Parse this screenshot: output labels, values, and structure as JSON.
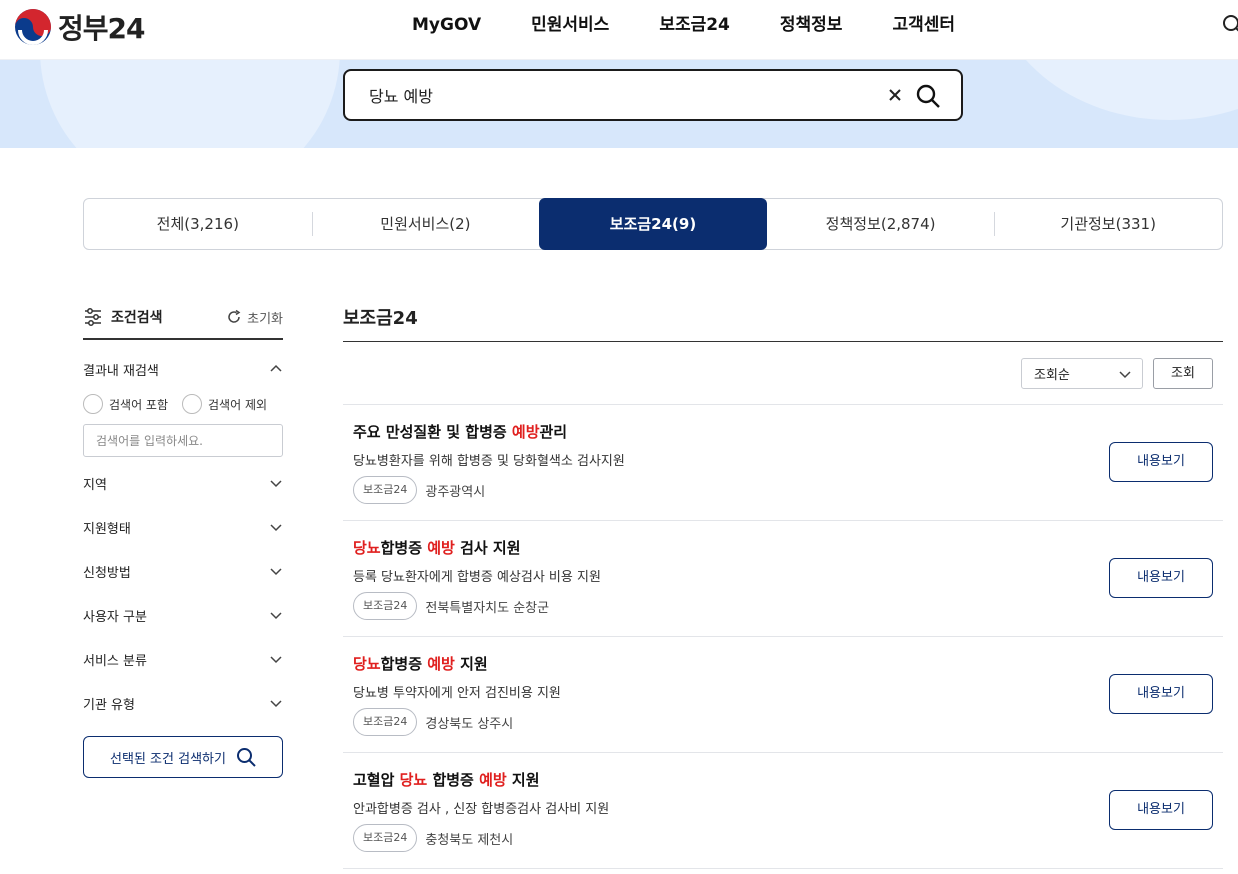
{
  "header": {
    "logo_text": "정부24",
    "nav": [
      "MyGOV",
      "민원서비스",
      "보조금24",
      "정책정보",
      "고객센터"
    ]
  },
  "search": {
    "value": "당뇨 예방"
  },
  "tabs": [
    {
      "label": "전체(3,216)",
      "active": false
    },
    {
      "label": "민원서비스(2)",
      "active": false
    },
    {
      "label": "보조금24(9)",
      "active": true
    },
    {
      "label": "정책정보(2,874)",
      "active": false
    },
    {
      "label": "기관정보(331)",
      "active": false
    }
  ],
  "sidebar": {
    "title": "조건검색",
    "reset_label": "초기화",
    "refine_label": "결과내 재검색",
    "include_label": "검색어 포함",
    "exclude_label": "검색어 제외",
    "input_placeholder": "검색어를 입력하세요.",
    "filters": [
      "지역",
      "지원형태",
      "신청방법",
      "사용자 구분",
      "서비스 분류",
      "기관 유형"
    ],
    "search_button": "선택된 조건 검색하기"
  },
  "main": {
    "title": "보조금24",
    "sort_value": "조회순",
    "sort_button": "조회",
    "view_label": "내용보기",
    "results": [
      {
        "title_parts": [
          {
            "t": "주요 만성질환 및 합병증 ",
            "hl": false
          },
          {
            "t": "예방",
            "hl": true
          },
          {
            "t": "관리",
            "hl": false
          }
        ],
        "desc": "당뇨병환자를 위해 합병증 및 당화혈색소 검사지원",
        "badge": "보조금24",
        "region": "광주광역시"
      },
      {
        "title_parts": [
          {
            "t": "당뇨",
            "hl": true
          },
          {
            "t": "합병증 ",
            "hl": false
          },
          {
            "t": "예방",
            "hl": true
          },
          {
            "t": " 검사 지원",
            "hl": false
          }
        ],
        "desc": "등록 당뇨환자에게 합병증 예상검사 비용 지원",
        "badge": "보조금24",
        "region": "전북특별자치도 순창군"
      },
      {
        "title_parts": [
          {
            "t": "당뇨",
            "hl": true
          },
          {
            "t": "합병증 ",
            "hl": false
          },
          {
            "t": "예방",
            "hl": true
          },
          {
            "t": " 지원",
            "hl": false
          }
        ],
        "desc": "당뇨병 투약자에게 안저 검진비용 지원",
        "badge": "보조금24",
        "region": "경상북도 상주시"
      },
      {
        "title_parts": [
          {
            "t": "고혈압 ",
            "hl": false
          },
          {
            "t": "당뇨",
            "hl": true
          },
          {
            "t": " 합병증 ",
            "hl": false
          },
          {
            "t": "예방",
            "hl": true
          },
          {
            "t": " 지원",
            "hl": false
          }
        ],
        "desc": "안과합병증 검사 , 신장 합병증검사 검사비 지원",
        "badge": "보조금24",
        "region": "충청북도 제천시"
      }
    ]
  },
  "colors": {
    "primary": "#0b2d6f",
    "highlight": "#e0201f",
    "band": "#d7e7fb"
  }
}
